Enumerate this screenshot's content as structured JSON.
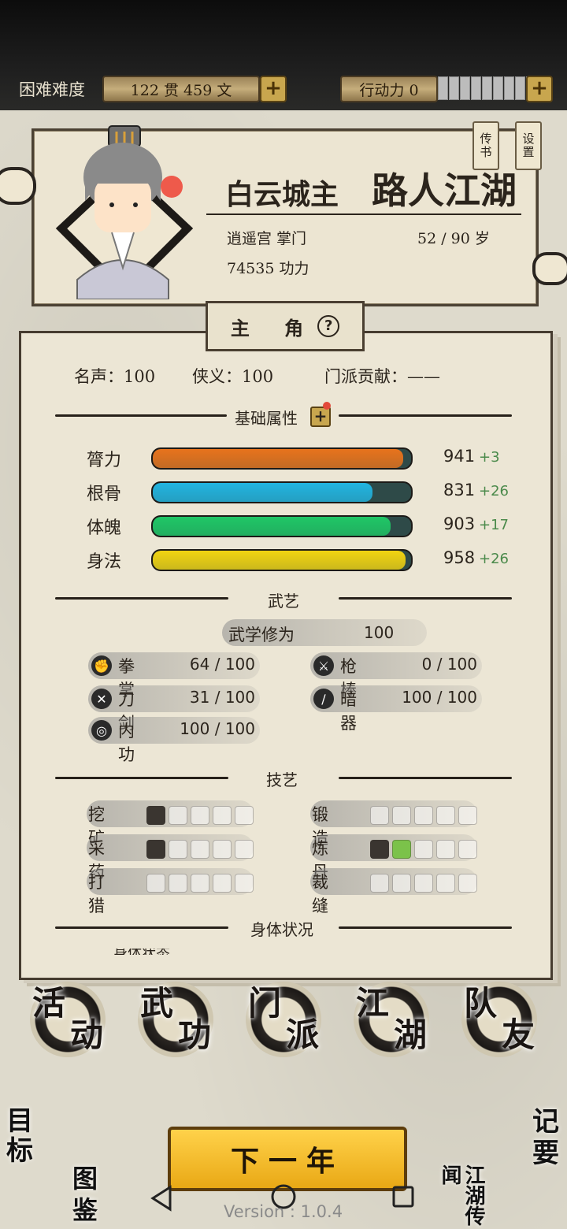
{
  "top": {
    "difficulty": "困难难度",
    "money": "122 贯  459 文",
    "action_label": "行动力 0",
    "plus": "+",
    "action_segments": 9
  },
  "profile": {
    "title": "白云城主",
    "name": "路人江湖",
    "sect_role": "逍遥宫 掌门",
    "age": "52 / 90 岁",
    "power": "74535 功力",
    "tags": [
      "传书",
      "设置"
    ]
  },
  "tab": {
    "label": "主 角",
    "help": "?"
  },
  "stats": {
    "fame": "名声：100",
    "chivalry": "侠义：100",
    "contribution": "门派贡献：——"
  },
  "sections": {
    "basic": "基础属性",
    "martial": "武艺",
    "crafts": "技艺",
    "body": "身体状况",
    "body_cut": "身体状态"
  },
  "attributes": [
    {
      "label": "膂力",
      "value": "941",
      "bonus": "+3",
      "fill": 0.97,
      "color": "#e8731c"
    },
    {
      "label": "根骨",
      "value": "831",
      "bonus": "+26",
      "fill": 0.85,
      "color": "#22b4e0"
    },
    {
      "label": "体魄",
      "value": "903",
      "bonus": "+17",
      "fill": 0.92,
      "color": "#1fc766"
    },
    {
      "label": "身法",
      "value": "958",
      "bonus": "+26",
      "fill": 0.98,
      "color": "#f2d411"
    }
  ],
  "martial": {
    "cultivation_label": "武学修为",
    "cultivation_value": "100",
    "skills": [
      {
        "label": "拳掌",
        "value": "64 / 100",
        "icon": "fist-icon"
      },
      {
        "label": "枪棒",
        "value": "0 / 100",
        "icon": "spear-icon"
      },
      {
        "label": "刀剑",
        "value": "31 / 100",
        "icon": "swords-icon"
      },
      {
        "label": "暗器",
        "value": "100 / 100",
        "icon": "dart-icon"
      },
      {
        "label": "内功",
        "value": "100 / 100",
        "icon": "inner-power-icon"
      }
    ]
  },
  "crafts": [
    {
      "label": "挖矿",
      "level": 1,
      "max": 5,
      "icon": "pickaxe-icon"
    },
    {
      "label": "锻造",
      "level": 0,
      "max": 5,
      "icon": "anvil-icon"
    },
    {
      "label": "采药",
      "level": 1,
      "max": 5,
      "icon": "herb-icon"
    },
    {
      "label": "炼丹",
      "level": 2,
      "max": 5,
      "icon": "mortar-icon"
    },
    {
      "label": "打猎",
      "level": 0,
      "max": 5,
      "icon": "bow-icon"
    },
    {
      "label": "裁缝",
      "level": 0,
      "max": 5,
      "icon": "needle-icon"
    }
  ],
  "nav": [
    {
      "top": "活",
      "bottom": "动"
    },
    {
      "top": "武",
      "bottom": "功"
    },
    {
      "top": "门",
      "bottom": "派"
    },
    {
      "top": "江",
      "bottom": "湖"
    },
    {
      "top": "队",
      "bottom": "友"
    }
  ],
  "corners": {
    "goal": "目标",
    "notes": "记要",
    "codex": "图鉴",
    "news": "江湖传闻"
  },
  "next_year": "下一年",
  "version": "Version : 1.0.4",
  "colors": {
    "accent_gold": "#e9a815",
    "ink": "#1a1512",
    "paper": "#ece6d5"
  }
}
